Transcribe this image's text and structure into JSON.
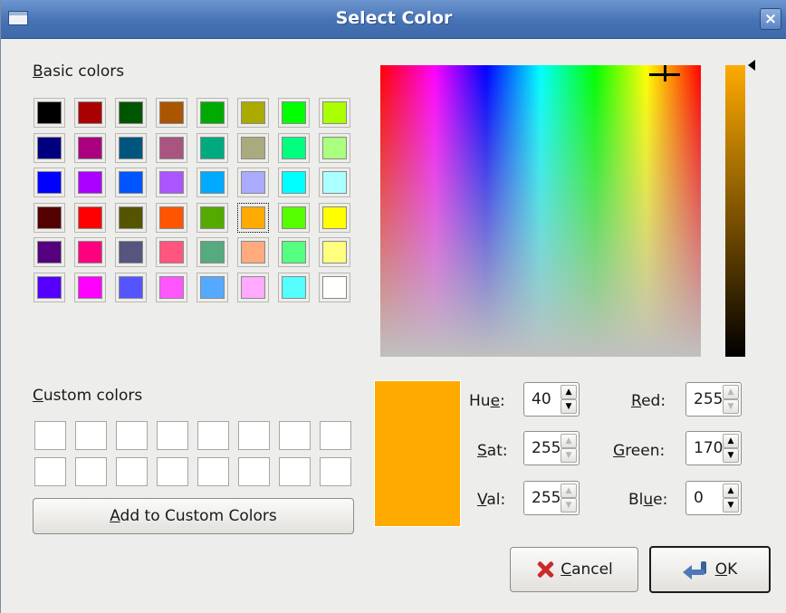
{
  "window": {
    "title": "Select Color",
    "close_glyph": "×"
  },
  "basic_colors": {
    "label_mnemonic": "B",
    "label_rest": "asic colors",
    "selected_index": 29,
    "swatches": [
      "#000000",
      "#aa0000",
      "#005500",
      "#aa5500",
      "#00aa00",
      "#aaaa00",
      "#00ff00",
      "#aaff00",
      "#00007f",
      "#aa007f",
      "#00557f",
      "#aa557f",
      "#00aa7f",
      "#aaaa7f",
      "#00ff7f",
      "#aaff7f",
      "#0000ff",
      "#aa00ff",
      "#0055ff",
      "#aa55ff",
      "#00aaff",
      "#aaaaff",
      "#00ffff",
      "#aaffff",
      "#550000",
      "#ff0000",
      "#555500",
      "#ff5500",
      "#55aa00",
      "#ffaa00",
      "#55ff00",
      "#ffff00",
      "#55007f",
      "#ff007f",
      "#55557f",
      "#ff557f",
      "#55aa7f",
      "#ffaa7f",
      "#55ff7f",
      "#ffff7f",
      "#5500ff",
      "#ff00ff",
      "#5555ff",
      "#ff55ff",
      "#55aaff",
      "#ffaaff",
      "#55ffff",
      "#ffffff"
    ]
  },
  "custom_colors": {
    "label_mnemonic": "C",
    "label_rest": "ustom colors",
    "count": 16,
    "add_button": {
      "mnemonic": "A",
      "rest": "dd to Custom Colors"
    }
  },
  "current_color": "#ffaa00",
  "fields": {
    "hue": {
      "pre": "Hu",
      "mn": "e",
      "post": ":",
      "value": "40"
    },
    "sat": {
      "pre": "",
      "mn": "S",
      "post": "at:",
      "value": "255"
    },
    "val": {
      "pre": "",
      "mn": "V",
      "post": "al:",
      "value": "255"
    },
    "red": {
      "pre": "",
      "mn": "R",
      "post": "ed:",
      "value": "255"
    },
    "green": {
      "pre": "",
      "mn": "G",
      "post": "reen:",
      "value": "170"
    },
    "blue": {
      "pre": "Bl",
      "mn": "u",
      "post": "e:",
      "value": "0"
    }
  },
  "buttons": {
    "cancel": {
      "mnemonic": "C",
      "rest": "ancel",
      "icon": "cancel-x-icon"
    },
    "ok": {
      "mnemonic": "O",
      "rest": "K",
      "icon": "ok-arrow-icon"
    }
  }
}
